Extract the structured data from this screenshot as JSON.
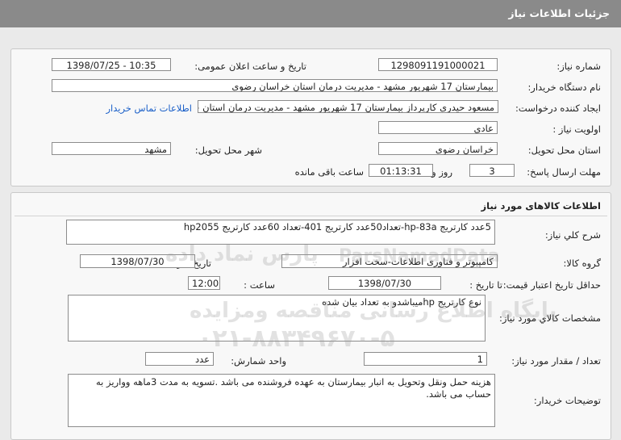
{
  "header": {
    "title": "جزئیات اطلاعات نیاز"
  },
  "info": {
    "need_number_label": "شماره نیاز:",
    "need_number": "1298091191000021",
    "announce_label": "تاریخ و ساعت اعلان عمومی:",
    "announce_value": "1398/07/25 - 10:35",
    "buyer_label": "نام دستگاه خریدار:",
    "buyer_value": "بیمارستان 17 شهریور مشهد - مدیریت درمان استان خراسان رضوی",
    "creator_label": "ایجاد کننده درخواست:",
    "creator_value": "مسعود حیدری کارپرداز بیمارستان 17 شهریور مشهد - مدیریت درمان استان خرا",
    "contact_link": "اطلاعات تماس خریدار",
    "priority_label": "اولویت نیاز :",
    "priority_value": "عادي",
    "province_label": "استان محل تحویل:",
    "province_value": "خراسان رضوی",
    "city_label": "شهر محل تحویل:",
    "city_value": "مشهد",
    "deadline_label": "مهلت ارسال پاسخ:",
    "days_value": "3",
    "days_unit": "روز و",
    "time_value": "01:13:31",
    "remaining_text": "ساعت باقی مانده"
  },
  "goods": {
    "section_title": "اطلاعات کالاهای مورد نیاز",
    "general_desc_label": "شرح کلي نیاز:",
    "general_desc_value": "5عدد کارتریج hp-83a-تعداد50عدد کارتریج 401-تعداد 60عدد کارتریج hp2055",
    "group_label": "گروه کالا:",
    "group_value": "کامپیوتر و فناوری اطلاعات-سخت افزار",
    "need_date_label": "تاریخ نیاز به کالا:",
    "need_date_value": "1398/07/30",
    "validity_label": "حداقل تاریخ اعتبار قیمت:",
    "until_date_label": "تا تاریخ :",
    "until_date_value": "1398/07/30",
    "hour_label": "ساعت :",
    "hour_value": "12:00",
    "spec_label": "مشخصات کالاي مورد نیاز:",
    "spec_value": "نوع کارتریج hpمیباشدو به تعداد بیان شده",
    "qty_label": "تعداد / مقدار مورد نیاز:",
    "qty_value": "1",
    "unit_label": "واحد شمارش:",
    "unit_value": "عدد",
    "buyer_notes_label": "توضیحات خریدار:",
    "buyer_notes_value": "هزینه حمل ونقل وتحویل به انبار بیمارستان به عهده فروشنده می باشد .تسویه به مدت 3ماهه وواریز به حساب می باشد."
  },
  "watermark": {
    "brand_fa": "پارس نماد داده",
    "brand_en": "ParsNamadData",
    "line1": "پایگاه اطلاع رسانی مناقصه ومزایده",
    "line2": "۰۲۱-۸۸۳۴۹۶۷۰-۵"
  }
}
